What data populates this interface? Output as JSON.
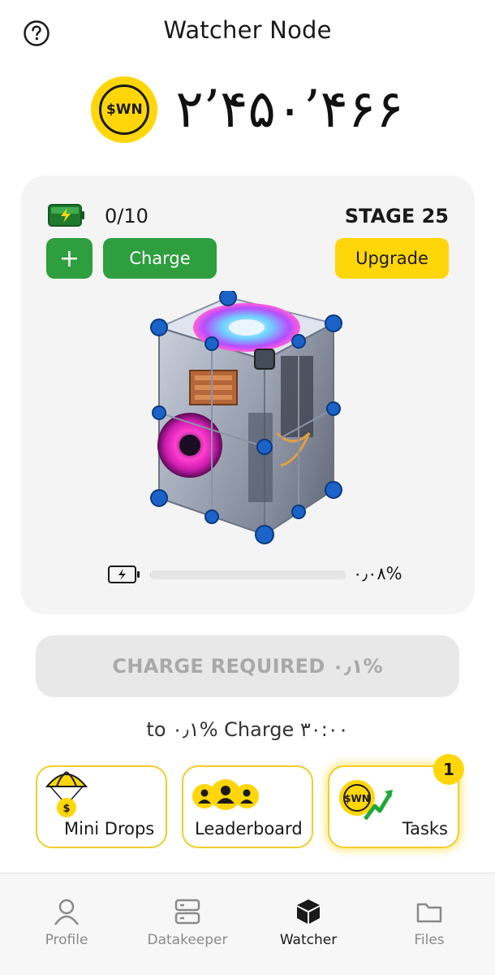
{
  "header": {
    "title": "Watcher Node",
    "balance": "۲’۴۵۰’۴۶۶",
    "coin_label": "$WN"
  },
  "energy": {
    "count": "0/10",
    "stage": "STAGE 25",
    "plus_label": "+",
    "charge_label": "Charge",
    "upgrade_label": "Upgrade"
  },
  "progress": {
    "percent_text": "۰٫۰۸%",
    "fraction": 0.0008
  },
  "charge_required": {
    "label": "CHARGE REQUIRED ۰٫۱%",
    "timer_text": "to ۰٫۱% Charge ۳۰:۰۰"
  },
  "features": [
    {
      "label": "Mini Drops",
      "icon": "parachute-coin-icon"
    },
    {
      "label": "Leaderboard",
      "icon": "people-icon"
    },
    {
      "label": "Tasks",
      "icon": "coin-arrow-icon",
      "badge": "1"
    }
  ],
  "nav": {
    "items": [
      {
        "label": "Profile",
        "icon": "user-icon"
      },
      {
        "label": "Datakeeper",
        "icon": "server-icon"
      },
      {
        "label": "Watcher",
        "icon": "cube-icon",
        "active": true
      },
      {
        "label": "Files",
        "icon": "folder-icon"
      }
    ]
  },
  "colors": {
    "accent_yellow": "#ffd60a",
    "accent_green": "#2e9e3e",
    "card_bg": "#f4f4f4",
    "disabled_text": "#a9a9a9"
  }
}
